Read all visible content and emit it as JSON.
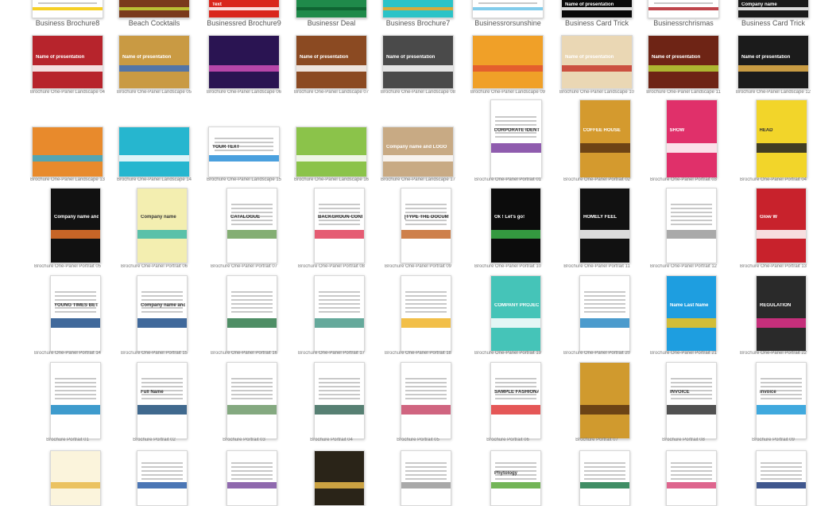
{
  "rows": [
    {
      "kind": "landscape-top",
      "tiles": [
        {
          "label": "Business Brochure8",
          "inner": "",
          "bg": "#ffffff",
          "accent": "#f4c800"
        },
        {
          "label": "Beach Cocktails",
          "inner": "",
          "bg": "#7a3a1c",
          "accent": "#c7d83a"
        },
        {
          "label": "Businessred Brochure9",
          "inner": "Text",
          "bg": "#d9261c",
          "accent": "#ffffff"
        },
        {
          "label": "Businessr  Deal",
          "inner": "",
          "bg": "#1f8a4a",
          "accent": "#0d5e2e"
        },
        {
          "label": "Business Brochure7",
          "inner": "",
          "bg": "#2bc3c7",
          "accent": "#f5a623"
        },
        {
          "label": "Businessrorsunshine",
          "inner": "",
          "bg": "#ffffff",
          "accent": "#6cc3e8"
        },
        {
          "label": "Business Card Trick",
          "inner": "Name of presentation",
          "bg": "#0a0a0a",
          "accent": "#ffffff"
        },
        {
          "label": "Businessrchrismas",
          "inner": "",
          "bg": "#ffffff",
          "accent": "#b3242c"
        },
        {
          "label": "Business Card Trick",
          "inner": "Company name",
          "bg": "#1a1a1a",
          "accent": "#ffffff"
        }
      ]
    },
    {
      "kind": "landscape",
      "tiles": [
        {
          "label": "Brochure One-Panel Landscape 04",
          "inner": "Name of presentation",
          "bg": "#b7242c",
          "accent": "#ffffff"
        },
        {
          "label": "Brochure One-Panel Landscape 05",
          "inner": "Name of presentation",
          "bg": "#c99a43",
          "accent": "#3e6fb8"
        },
        {
          "label": "Brochure One-Panel Landscape 06",
          "inner": "",
          "bg": "#2a1452",
          "accent": "#d04fb8"
        },
        {
          "label": "Brochure One-Panel Landscape 07",
          "inner": "Name of presentation",
          "bg": "#8b4a22",
          "accent": "#ffffff"
        },
        {
          "label": "Brochure One-Panel Landscape 08",
          "inner": "Name of presentation",
          "bg": "#4a4a4a",
          "accent": "#ffffff"
        },
        {
          "label": "Brochure One-Panel Landscape 09",
          "inner": "",
          "bg": "#f0a028",
          "accent": "#e2532e"
        },
        {
          "label": "Brochure One-Panel Landscape 10",
          "inner": "Name of presentation",
          "bg": "#ead7b4",
          "accent": "#c6382c"
        },
        {
          "label": "Brochure One-Panel Landscape 11",
          "inner": "Name of presentation",
          "bg": "#6e2415",
          "accent": "#b9d036"
        },
        {
          "label": "Brochure One-Panel Landscape 12",
          "inner": "Name of presentation",
          "bg": "#1b1b1b",
          "accent": "#e6b24a"
        }
      ]
    },
    {
      "kind": "mixed",
      "tiles": [
        {
          "label": "Brochure One-Panel Landscape 13",
          "inner": "",
          "bg": "#e88a2c",
          "accent": "#3aa9c9",
          "shape": "land"
        },
        {
          "label": "Brochure One-Panel Landscape 14",
          "inner": "",
          "bg": "#26b6cf",
          "accent": "#ffffff",
          "shape": "land"
        },
        {
          "label": "Brochure One-Panel Landscape 15",
          "inner": "YOUR TEXT",
          "bg": "#ffffff",
          "accent": "#2a8fd8",
          "shape": "land"
        },
        {
          "label": "Brochure One-Panel Landscape 16",
          "inner": "",
          "bg": "#8bc34a",
          "accent": "#ffffff",
          "shape": "land"
        },
        {
          "label": "Brochure One-Panel Landscape 17",
          "inner": "Company name and LOGO",
          "bg": "#c8aa84",
          "accent": "#ffffff",
          "shape": "land"
        },
        {
          "label": "Brochure One-Panel Portrait 01",
          "inner": "CORPORATE IDENTITY BUSINESS",
          "bg": "#ffffff",
          "accent": "#7b3fa0",
          "shape": "port"
        },
        {
          "label": "Brochure One-Panel Portrait 02",
          "inner": "COFFEE HOUSE",
          "bg": "#d49a2e",
          "accent": "#5a3410",
          "shape": "port"
        },
        {
          "label": "Brochure One-Panel Portrait 03",
          "inner": "SHOW",
          "bg": "#e0306a",
          "accent": "#ffffff",
          "shape": "port"
        },
        {
          "label": "Brochure One-Panel Portrait 04",
          "inner": "HEAD",
          "bg": "#f2d52a",
          "accent": "#222222",
          "shape": "port"
        }
      ]
    },
    {
      "kind": "portrait",
      "tiles": [
        {
          "label": "Brochure One-Panel Portrait 05",
          "inner": "Company name and LOGO",
          "bg": "#111111",
          "accent": "#e8742c"
        },
        {
          "label": "Brochure One-Panel Portrait 06",
          "inner": "Company name",
          "bg": "#f3eeb0",
          "accent": "#3fb8a8"
        },
        {
          "label": "Brochure One-Panel Portrait 07",
          "inner": "CATALOGUE",
          "bg": "#ffffff",
          "accent": "#6fa05a"
        },
        {
          "label": "Brochure One-Panel Portrait 08",
          "inner": "BACKGROUN CONFETTI",
          "bg": "#ffffff",
          "accent": "#e0405a"
        },
        {
          "label": "Brochure One-Panel Portrait 09",
          "inner": "[TYPE THE DOCUMENT TITLE]",
          "bg": "#ffffff",
          "accent": "#c56a2c"
        },
        {
          "label": "Brochure One-Panel Portrait 10",
          "inner": "Ok ! Let's go!",
          "bg": "#0c0c0c",
          "accent": "#3cb34a"
        },
        {
          "label": "Brochure One-Panel Portrait 11",
          "inner": "HOMELY FEEL",
          "bg": "#111111",
          "accent": "#ffffff"
        },
        {
          "label": "Brochure One-Panel Portrait 12",
          "inner": "",
          "bg": "#ffffff",
          "accent": "#9a9a9a"
        },
        {
          "label": "Brochure One-Panel Portrait 13",
          "inner": "Glow W",
          "bg": "#c8222c",
          "accent": "#ffffff"
        }
      ]
    },
    {
      "kind": "portrait",
      "tiles": [
        {
          "label": "Brochure One-Panel Portrait 14",
          "inner": "YOUNG TIMES BETTER",
          "bg": "#ffffff",
          "accent": "#1f4f8a"
        },
        {
          "label": "Brochure One-Panel Portrait 15",
          "inner": "Company name and LOGO",
          "bg": "#ffffff",
          "accent": "#1f4f8a"
        },
        {
          "label": "Brochure One-Panel Portrait 16",
          "inner": "",
          "bg": "#ffffff",
          "accent": "#2f7a4a"
        },
        {
          "label": "Brochure One-Panel Portrait 17",
          "inner": "",
          "bg": "#ffffff",
          "accent": "#4a9a8a"
        },
        {
          "label": "Brochure One-Panel Portrait 18",
          "inner": "",
          "bg": "#ffffff",
          "accent": "#f0b428"
        },
        {
          "label": "Brochure One-Panel Portrait 19",
          "inner": "COMPANY PROJECT",
          "bg": "#45c4b8",
          "accent": "#ffffff"
        },
        {
          "label": "Brochure One-Panel Portrait 20",
          "inner": "",
          "bg": "#ffffff",
          "accent": "#2c8ac4"
        },
        {
          "label": "Brochure One-Panel Portrait 21",
          "inner": "Name Last Name",
          "bg": "#1e9ee0",
          "accent": "#f2c21a"
        },
        {
          "label": "Brochure One-Panel Portrait 22",
          "inner": "REGULATION",
          "bg": "#2a2a2a",
          "accent": "#e0308a"
        }
      ]
    },
    {
      "kind": "portrait",
      "tiles": [
        {
          "label": "Brochure Portrait 01",
          "inner": "",
          "bg": "#ffffff",
          "accent": "#1c8ac4"
        },
        {
          "label": "Brochure Portrait 02",
          "inner": "Full Name",
          "bg": "#ffffff",
          "accent": "#1e4f7a"
        },
        {
          "label": "Brochure Portrait 03",
          "inner": "",
          "bg": "#ffffff",
          "accent": "#6f9a6a"
        },
        {
          "label": "Brochure Portrait 04",
          "inner": "",
          "bg": "#ffffff",
          "accent": "#3a6a5a"
        },
        {
          "label": "Brochure Portrait 05",
          "inner": "",
          "bg": "#ffffff",
          "accent": "#c84a6a"
        },
        {
          "label": "Brochure Portrait 06",
          "inner": "SAMPLE FASHIONABLY",
          "bg": "#ffffff",
          "accent": "#e03a3a"
        },
        {
          "label": "Brochure Portrait 07",
          "inner": "",
          "bg": "#d09a2e",
          "accent": "#5a3410"
        },
        {
          "label": "Brochure Portrait 08",
          "inner": "INVOICE",
          "bg": "#ffffff",
          "accent": "#333333"
        },
        {
          "label": "Brochure Portrait 09",
          "inner": "invoice",
          "bg": "#ffffff",
          "accent": "#1e9ad8"
        }
      ]
    },
    {
      "kind": "partial",
      "tiles": [
        {
          "label": "",
          "inner": "",
          "bg": "#fbf4dc",
          "accent": "#e8b84a"
        },
        {
          "label": "",
          "inner": "",
          "bg": "#ffffff",
          "accent": "#2c5ea8"
        },
        {
          "label": "",
          "inner": "",
          "bg": "#ffffff",
          "accent": "#7b4fa0"
        },
        {
          "label": "",
          "inner": "",
          "bg": "#2a2418",
          "accent": "#e8b84a"
        },
        {
          "label": "",
          "inner": "",
          "bg": "#ffffff",
          "accent": "#9a9a9a"
        },
        {
          "label": "",
          "inner": "Phytology",
          "bg": "#ffffff",
          "accent": "#5aa83a"
        },
        {
          "label": "",
          "inner": "",
          "bg": "#ffffff",
          "accent": "#1e7a4a"
        },
        {
          "label": "",
          "inner": "",
          "bg": "#ffffff",
          "accent": "#d84a7a"
        },
        {
          "label": "",
          "inner": "",
          "bg": "#ffffff",
          "accent": "#1e3a7a"
        }
      ]
    }
  ]
}
